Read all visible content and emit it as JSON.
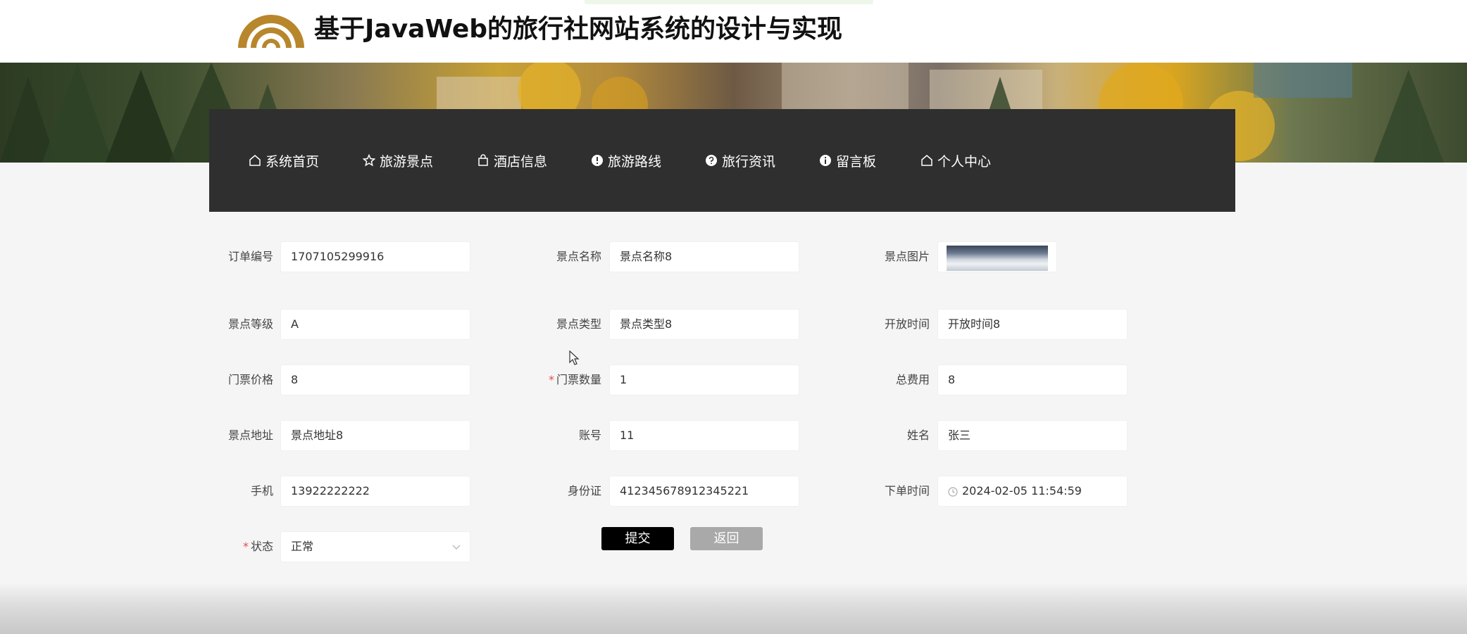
{
  "header": {
    "title": "基于JavaWeb的旅行社网站系统的设计与实现",
    "brand_color": "#b8862b"
  },
  "nav": {
    "items": [
      {
        "label": "系统首页",
        "icon": "home-icon"
      },
      {
        "label": "旅游景点",
        "icon": "star-icon"
      },
      {
        "label": "酒店信息",
        "icon": "bag-icon"
      },
      {
        "label": "旅游路线",
        "icon": "exclamation-circle-icon"
      },
      {
        "label": "旅行资讯",
        "icon": "question-circle-icon"
      },
      {
        "label": "留言板",
        "icon": "info-circle-icon"
      },
      {
        "label": "个人中心",
        "icon": "home-icon"
      }
    ]
  },
  "form": {
    "order_no": {
      "label": "订单编号",
      "value": "1707105299916"
    },
    "spot_name": {
      "label": "景点名称",
      "value": "景点名称8"
    },
    "spot_image": {
      "label": "景点图片"
    },
    "spot_level": {
      "label": "景点等级",
      "value": "A"
    },
    "spot_type": {
      "label": "景点类型",
      "value": "景点类型8"
    },
    "open_time": {
      "label": "开放时间",
      "value": "开放时间8"
    },
    "ticket_price": {
      "label": "门票价格",
      "value": "8"
    },
    "ticket_qty": {
      "label": "门票数量",
      "value": "1",
      "required_mark": "*"
    },
    "total_cost": {
      "label": "总费用",
      "value": "8"
    },
    "spot_address": {
      "label": "景点地址",
      "value": "景点地址8"
    },
    "account": {
      "label": "账号",
      "value": "11"
    },
    "name": {
      "label": "姓名",
      "value": "张三"
    },
    "phone": {
      "label": "手机",
      "value": "13922222222"
    },
    "id_card": {
      "label": "身份证",
      "value": "412345678912345221"
    },
    "order_time": {
      "label": "下单时间",
      "value": "2024-02-05 11:54:59"
    },
    "status": {
      "label": "状态",
      "value": "正常",
      "required_mark": "*"
    }
  },
  "buttons": {
    "submit": "提交",
    "back": "返回"
  },
  "colors": {
    "nav_bg": "#2f2f2f",
    "submit_bg": "#000000",
    "back_bg": "#a9a9a9",
    "required": "#e34d4d"
  }
}
